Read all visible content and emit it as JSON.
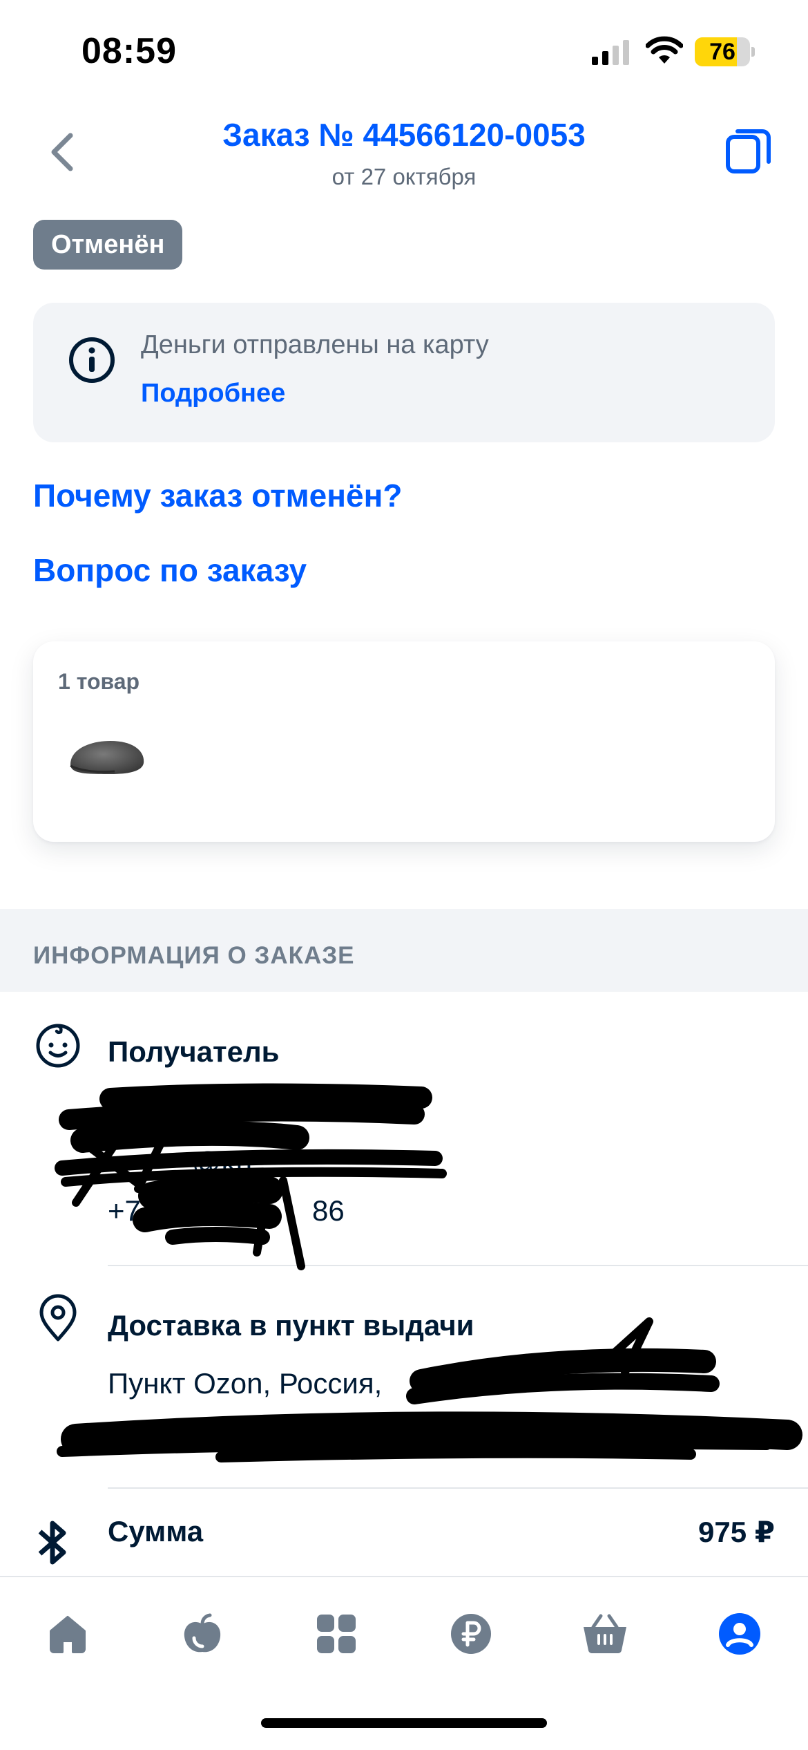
{
  "status_bar": {
    "time": "08:59",
    "battery": "76",
    "battery_level": 0.76
  },
  "header": {
    "title": "Заказ № 44566120-0053",
    "subtitle": "от 27 октября",
    "back_icon": "chevron-left-icon",
    "copy_icon": "copy-icon"
  },
  "order_status": "Отменён",
  "info_card": {
    "icon": "info-icon",
    "text": "Деньги отправлены на карту",
    "link": "Подробнее"
  },
  "links": {
    "why_cancelled": "Почему заказ отменён?",
    "order_question": "Вопрос по заказу"
  },
  "products": {
    "count_label": "1 товар",
    "items": [
      {
        "image": "flat-cap-image"
      }
    ]
  },
  "order_info": {
    "section_title": "ИНФОРМАЦИЯ О ЗАКАЗЕ",
    "recipient": {
      "icon": "smiley-icon",
      "title": "Получатель",
      "email_visible": "@kh",
      "phone_start": "+7",
      "phone_end": "86"
    },
    "delivery": {
      "icon": "location-pin-icon",
      "title": "Доставка в пункт выдачи",
      "address_visible": "Пункт Ozon, Россия,"
    },
    "sum": {
      "icon": "bluetooth-icon",
      "title": "Сумма",
      "amount": "975 ₽"
    }
  },
  "colors": {
    "accent": "#005bff",
    "text": "#001a34",
    "secondary": "#5e6a79",
    "badge": "#6f7d8c",
    "surface": "#f2f4f7"
  },
  "bottom_nav": [
    {
      "name": "home",
      "icon": "home-icon"
    },
    {
      "name": "fresh",
      "icon": "apple-icon"
    },
    {
      "name": "catalog",
      "icon": "grid-icon"
    },
    {
      "name": "finance",
      "icon": "ruble-icon"
    },
    {
      "name": "cart",
      "icon": "basket-icon"
    },
    {
      "name": "profile",
      "icon": "profile-icon",
      "active": true
    }
  ]
}
